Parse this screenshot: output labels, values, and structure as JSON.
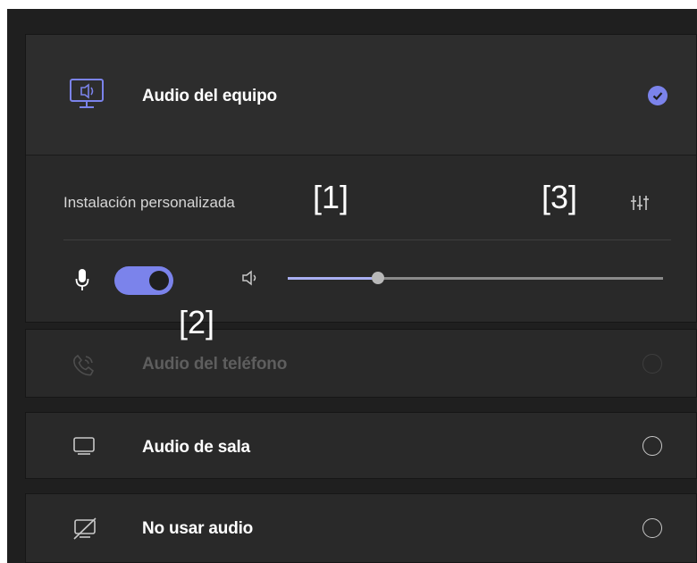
{
  "selected_option": {
    "title": "Audio del equipo",
    "icon": "computer-speaker-icon",
    "custom_setup_label": "Instalación personalizada",
    "settings_icon": "device-settings-icon",
    "mic_icon": "microphone-icon",
    "mic_enabled": true,
    "speaker_icon": "speaker-icon",
    "volume": 0.24
  },
  "options": [
    {
      "title": "Audio del teléfono",
      "icon": "phone-icon",
      "disabled": true
    },
    {
      "title": "Audio de sala",
      "icon": "room-display-icon",
      "disabled": false
    },
    {
      "title": "No usar audio",
      "icon": "no-audio-icon",
      "disabled": false
    }
  ],
  "annotations": [
    "[1]",
    "[2]",
    "[3]"
  ],
  "colors": {
    "accent": "#7b83eb",
    "background": "#1f1f1f",
    "card": "#292929"
  }
}
